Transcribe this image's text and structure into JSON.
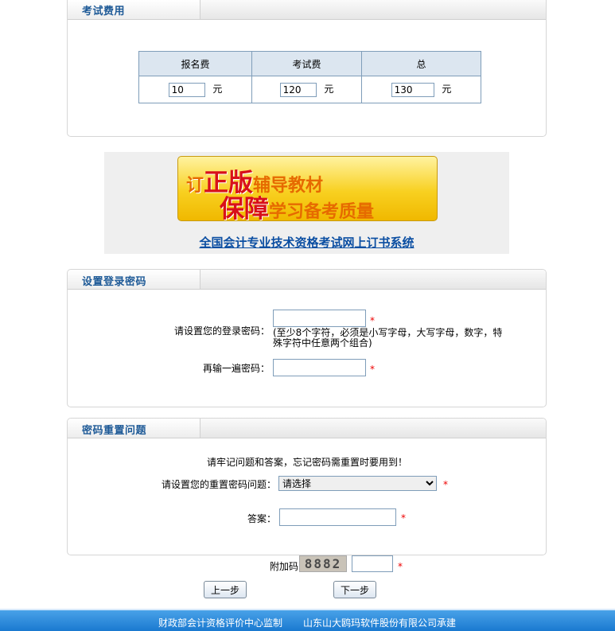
{
  "fee_panel": {
    "title": "考试费用",
    "headers": [
      "报名费",
      "考试费",
      "总"
    ],
    "values": [
      "10",
      "120",
      "130"
    ],
    "unit": "元"
  },
  "ad": {
    "line1_big": "正版",
    "line1_pre": "订",
    "line1_small": "辅导教材",
    "line2_big": "保障",
    "line2_small": "学习备考质量",
    "link_text": "全国会计专业技术资格考试网上订书系统"
  },
  "password_panel": {
    "title": "设置登录密码",
    "password_label": "请设置您的登录密码：",
    "password_hint": "(至少8个字符，必须是小写字母，大写字母，数字，特殊字符中任意两个组合)",
    "confirm_label": "再输一遍密码：",
    "required_mark": "*"
  },
  "reset_panel": {
    "title": "密码重置问题",
    "notice": "请牢记问题和答案，忘记密码需重置时要用到！",
    "question_label": "请设置您的重置密码问题：",
    "question_selected": "请选择",
    "answer_label": "答案：",
    "required_mark": "*"
  },
  "captcha": {
    "label": "附加码",
    "code": "8882",
    "required_mark": "*"
  },
  "buttons": {
    "prev": "上一步",
    "next": "下一步"
  },
  "footer": {
    "left": "财政部会计资格评价中心监制",
    "right": "山东山大鸥玛软件股份有限公司承建"
  }
}
